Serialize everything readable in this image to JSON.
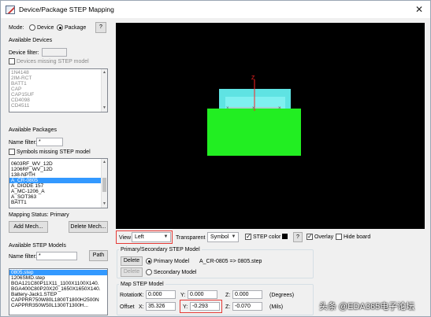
{
  "window": {
    "title": "Device/Package STEP Mapping",
    "close": "✕"
  },
  "mode": {
    "label": "Mode:",
    "device": "Device",
    "package": "Package",
    "help": "?"
  },
  "devices": {
    "title": "Available Devices",
    "filter_label": "Device filter:",
    "filter_value": "",
    "missing_label": "Devices missing STEP model",
    "items": [
      "1N4148",
      "2IM-RCT",
      "BATT1",
      "CAP",
      "CAP15UF",
      "CD4098",
      "CD4511"
    ]
  },
  "packages": {
    "title": "Available Packages",
    "filter_label": "Name filter:",
    "filter_value": "*",
    "missing_label": "Symbols missing STEP model",
    "items": [
      "0603RF_WV_12D",
      "1206RF_WV_12D",
      "138-NPTH",
      "A_CR-0805",
      "A_DIODE 157",
      "A_MC-1206_A",
      "A_SOT363",
      "BATT1"
    ],
    "selected_index": 3
  },
  "mapping_status": "Mapping Status: Primary",
  "buttons": {
    "add_mech": "Add Mech...",
    "delete_mech": "Delete Mech..."
  },
  "step_models": {
    "title": "Available STEP Models",
    "filter_label": "Name filter:",
    "filter_value": "*",
    "path_button": "Path",
    "items": [
      "0805.step",
      "1206SMD.step",
      "BGA121C80P11X11_1100X1100X140.",
      "BGA400C80P20X20_1650X1650X140.",
      "Battery-Jack1.STEP",
      "CAPPRR750W80L1800T1800H2500N",
      "CAPPRR350W50L1300T1300H..."
    ],
    "selected_index": 0
  },
  "toolbar": {
    "view_label": "View",
    "view_value": "Left",
    "transparent_label": "Transparent",
    "transparent_value": "Symbol",
    "step_color_label": "STEP color",
    "help": "?",
    "overlay_label": "Overlay",
    "hide_board_label": "Hide board"
  },
  "primary_group": {
    "title": "Primary/Secondary STEP Model",
    "delete_label": "Delete",
    "primary_label": "Primary Model",
    "mapping_text": "A_CR-0805 => 0805.step",
    "delete2_label": "Delete",
    "secondary_label": "Secondary Model"
  },
  "map_group": {
    "title": "Map STEP Model",
    "rotation_label": "Rotation",
    "offset_label": "Offset",
    "x_label": "X:",
    "y_label": "Y:",
    "z_label": "Z:",
    "rotation_x": "0.000",
    "rotation_y": "0.000",
    "rotation_z": "0.000",
    "offset_x": "35.326",
    "offset_y": "-0.293",
    "offset_z": "-0.070",
    "degrees_label": "(Degrees)",
    "mils_label": "(Mils)"
  },
  "watermark": "头条 @EDA365电子论坛",
  "colors": {
    "model_cyan": "#5fe3e3",
    "pad_green": "#22ee22",
    "axis_red": "#ff2222",
    "selection": "#3399ff"
  }
}
